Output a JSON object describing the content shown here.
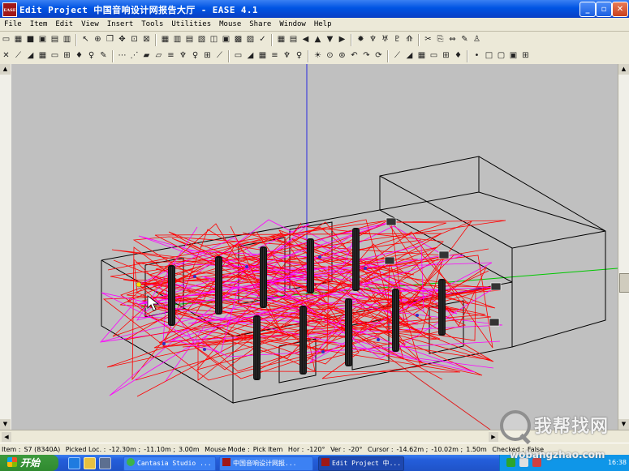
{
  "window": {
    "app_icon_text": "EASE",
    "title": "Edit Project  中国音响设计网报告大厅  - EASE 4.1",
    "min_label": "_",
    "max_label": "▫",
    "close_label": "✕"
  },
  "menu": [
    "File",
    "Item",
    "Edit",
    "View",
    "Insert",
    "Tools",
    "Utilities",
    "Mouse",
    "Share",
    "Window",
    "Help"
  ],
  "toolbar_row1_icons": [
    "new-icon",
    "open-icon",
    "save-icon",
    "print-icon",
    "print-preview-icon",
    "export-icon",
    "select-arrow-icon",
    "target-icon",
    "copy-icon",
    "move-icon",
    "zoom-fit-icon",
    "zoom-window-icon",
    "view-top-icon",
    "view-front-icon",
    "view-side-icon",
    "view-iso-icon",
    "layer-icon",
    "room-icon",
    "render-icon",
    "speaker-array-icon",
    "checks-icon",
    "grid-icon",
    "table-icon",
    "arrow-left-icon",
    "arrow-up-icon",
    "arrow-down-icon",
    "arrow-right-icon",
    "sun-icon",
    "speaker-pair-icon",
    "speaker-down-icon",
    "speaker-group-icon",
    "rays-icon",
    "cut-icon",
    "paste-icon",
    "mirror-icon",
    "properties-icon",
    "audience-icon"
  ],
  "toolbar_row2_icons": [
    "delete-icon",
    "vertex-icon",
    "face-icon",
    "edge-icon",
    "wall-icon",
    "area-icon",
    "speaker-icon",
    "listener-icon",
    "label-icon",
    "hide-icon",
    "show-icon",
    "wall-hide-icon",
    "area-hide-icon",
    "label-hide-icon",
    "speaker-hide-icon",
    "listener-hide-icon",
    "all-hide-icon",
    "face-show-icon",
    "edge-show-icon",
    "wall-show-icon",
    "area-show-icon",
    "label-show-icon",
    "speaker-show-icon",
    "listener-show-icon",
    "light-icon",
    "pin-icon",
    "pin-face-icon",
    "undo-icon",
    "redo-icon",
    "refresh-icon",
    "vertex-select-icon",
    "edge-select-icon",
    "face-select-icon",
    "wall-select-icon",
    "area-select-icon",
    "speaker-select-icon",
    "point-icon",
    "rect-icon",
    "box-icon",
    "cube-icon",
    "window-icon"
  ],
  "viewport": {
    "background": "#c0c0c0",
    "room_line_color": "#000000",
    "ray_color": "#ff0000",
    "ray_color_alt": "#ff00ff",
    "axis_x_color": "#00c800",
    "axis_z_color": "#0000ff",
    "pillar_color": "#111111",
    "listener_color": "#3030c0"
  },
  "status": {
    "item_label": "Item :",
    "item_value": "S7 (8340A)",
    "picked_loc_label": "Picked Loc. :",
    "picked_x": "-12.30m ;",
    "picked_y": "-11.10m ;",
    "picked_z": "3.00m",
    "mouse_mode_label": "Mouse Mode :",
    "mouse_mode_value": "Pick Item",
    "hor_label": "Hor :",
    "hor_value": "-120°",
    "ver_label": "Ver :",
    "ver_value": "-20°",
    "cursor_label": "Cursor :",
    "cursor_x": "-14.62m ;",
    "cursor_y": "-10.02m ;",
    "cursor_z": "1.50m",
    "checked_label": "Checked :",
    "checked_value": "False"
  },
  "taskbar": {
    "start_label": "开始",
    "tasks": [
      {
        "label": "Cantasia Studio ..."
      },
      {
        "label": "中国音响设计网报..."
      },
      {
        "label": "Edit Project  中..."
      }
    ],
    "time": "16:38"
  },
  "watermark": {
    "text": "我帮找网",
    "url": "wobangzhao.com"
  }
}
